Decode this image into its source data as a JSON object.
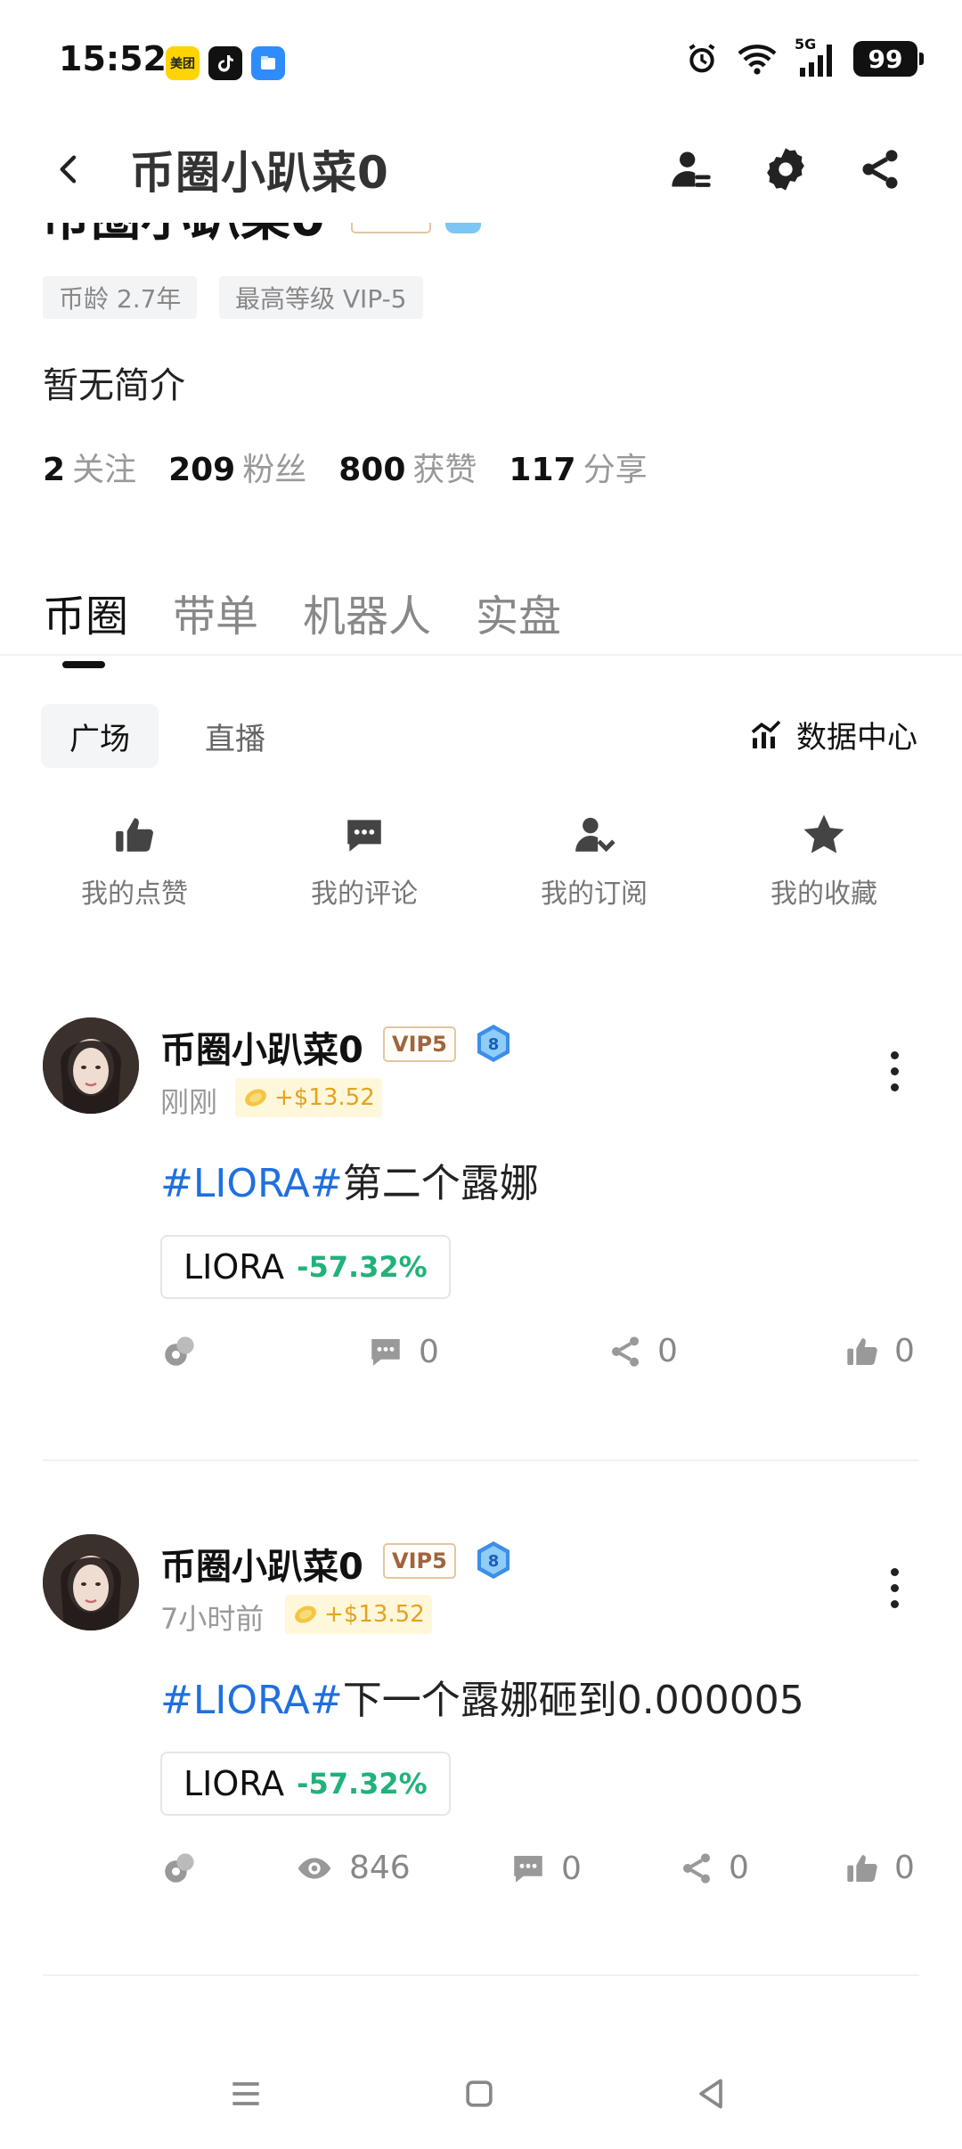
{
  "status_bar": {
    "time": "15:52",
    "apps": [
      "美团",
      "TikTok",
      "Files"
    ],
    "network": "5G",
    "battery": "99"
  },
  "nav": {
    "title": "币圈小趴菜0",
    "icons": [
      "back-icon",
      "user-settings-icon",
      "gear-icon",
      "share-icon"
    ]
  },
  "profile": {
    "name": "币圈小趴菜0",
    "tags": [
      "币龄 2.7年",
      "最高等级 VIP-5"
    ],
    "bio": "暂无简介",
    "stats": [
      {
        "num": "2",
        "label": "关注"
      },
      {
        "num": "209",
        "label": "粉丝"
      },
      {
        "num": "800",
        "label": "获赞"
      },
      {
        "num": "117",
        "label": "分享"
      }
    ]
  },
  "tabs": [
    {
      "label": "币圈",
      "active": true
    },
    {
      "label": "带单",
      "active": false
    },
    {
      "label": "机器人",
      "active": false
    },
    {
      "label": "实盘",
      "active": false
    }
  ],
  "sub_tabs": [
    {
      "label": "广场",
      "active": true
    },
    {
      "label": "直播",
      "active": false
    }
  ],
  "data_center": "数据中心",
  "quick_actions": [
    {
      "label": "我的点赞",
      "icon": "thumbs-up-icon"
    },
    {
      "label": "我的评论",
      "icon": "comment-icon"
    },
    {
      "label": "我的订阅",
      "icon": "subscribe-icon"
    },
    {
      "label": "我的收藏",
      "icon": "star-icon"
    }
  ],
  "posts": [
    {
      "author": "币圈小趴菜0",
      "vip": "VIP5",
      "level": "8",
      "time": "刚刚",
      "earn": "+$13.52",
      "hashtag": "#LIORA#",
      "text": "第二个露娜",
      "coin": "LIORA",
      "change": "-57.32%",
      "comments": "0",
      "shares": "0",
      "likes": "0"
    },
    {
      "author": "币圈小趴菜0",
      "vip": "VIP5",
      "level": "8",
      "time": "7小时前",
      "earn": "+$13.52",
      "hashtag": "#LIORA#",
      "text": "下一个露娜砸到0.000005",
      "coin": "LIORA",
      "change": "-57.32%",
      "views": "846",
      "comments": "0",
      "shares": "0",
      "likes": "0"
    }
  ],
  "colors": {
    "accent_blue": "#1f6fe0",
    "negative_change": "#20b27a",
    "earn_yellow": "#e3a31f",
    "vip_brown": "#a0643e"
  }
}
